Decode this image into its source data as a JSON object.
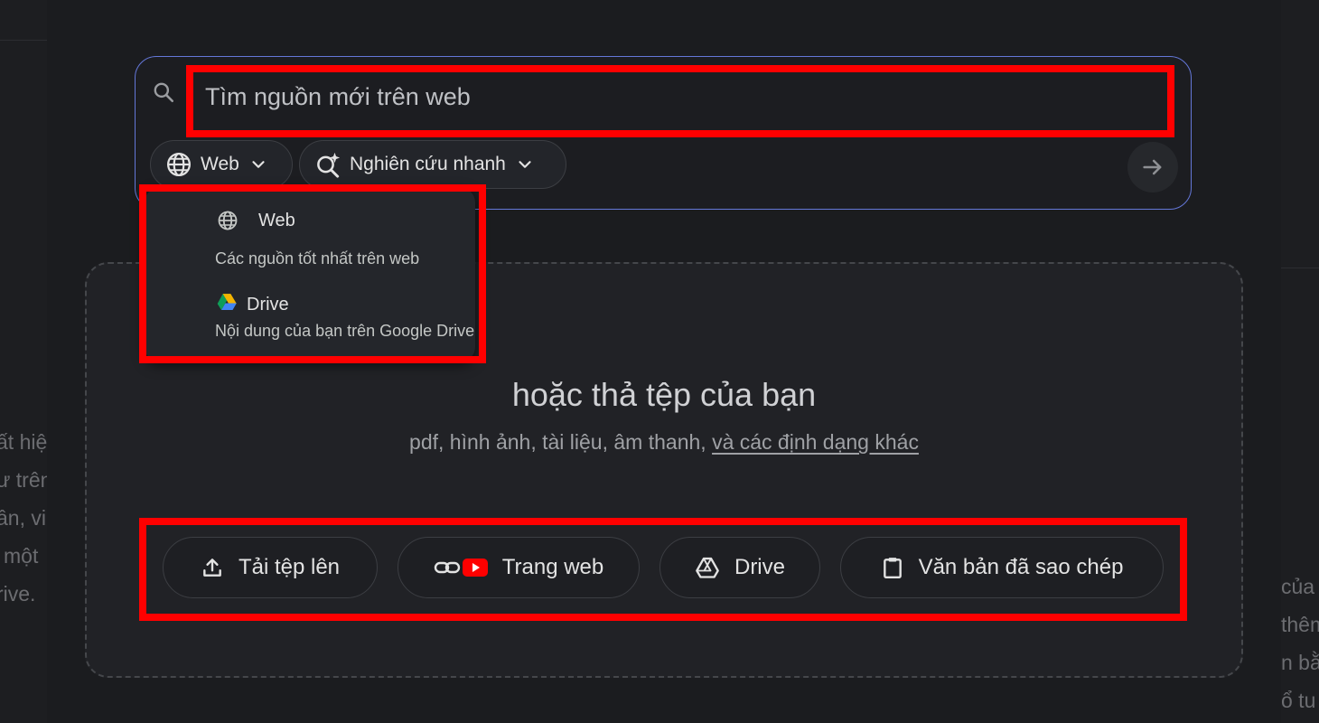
{
  "background": {
    "left_partial_lines": [
      "ất hiệ",
      "ư trên",
      "ần, vi",
      "một",
      "rive."
    ],
    "right_partial_lines": [
      "của",
      "thêm",
      "n bằ",
      "ổ tu"
    ]
  },
  "search": {
    "placeholder": "Tìm nguồn mới trên web",
    "icon": "search-icon",
    "submit_icon": "arrow-right-icon"
  },
  "source_chip": {
    "label": "Web",
    "icon": "globe-icon"
  },
  "mode_chip": {
    "label": "Nghiên cứu nhanh",
    "icon": "sparkle-search-icon"
  },
  "dropdown": {
    "items": [
      {
        "title": "Web",
        "description": "Các nguồn tốt nhất trên web",
        "icon": "globe-icon"
      },
      {
        "title": "Drive",
        "description": "Nội dung của bạn trên Google Drive",
        "icon": "google-drive-icon"
      }
    ]
  },
  "drop_zone": {
    "title": "hoặc thả tệp của bạn",
    "subtitle": "pdf, hình ảnh, tài liệu, âm thanh,",
    "subtitle_link": "và các định dạng khác"
  },
  "buttons": {
    "upload": "Tải tệp lên",
    "website": "Trang web",
    "drive": "Drive",
    "paste": "Văn bản đã sao chép"
  },
  "colors": {
    "background": "#1b1c1f",
    "search_border": "#6477d8",
    "highlight": "#ff0000",
    "youtube_red": "#ff0000"
  }
}
